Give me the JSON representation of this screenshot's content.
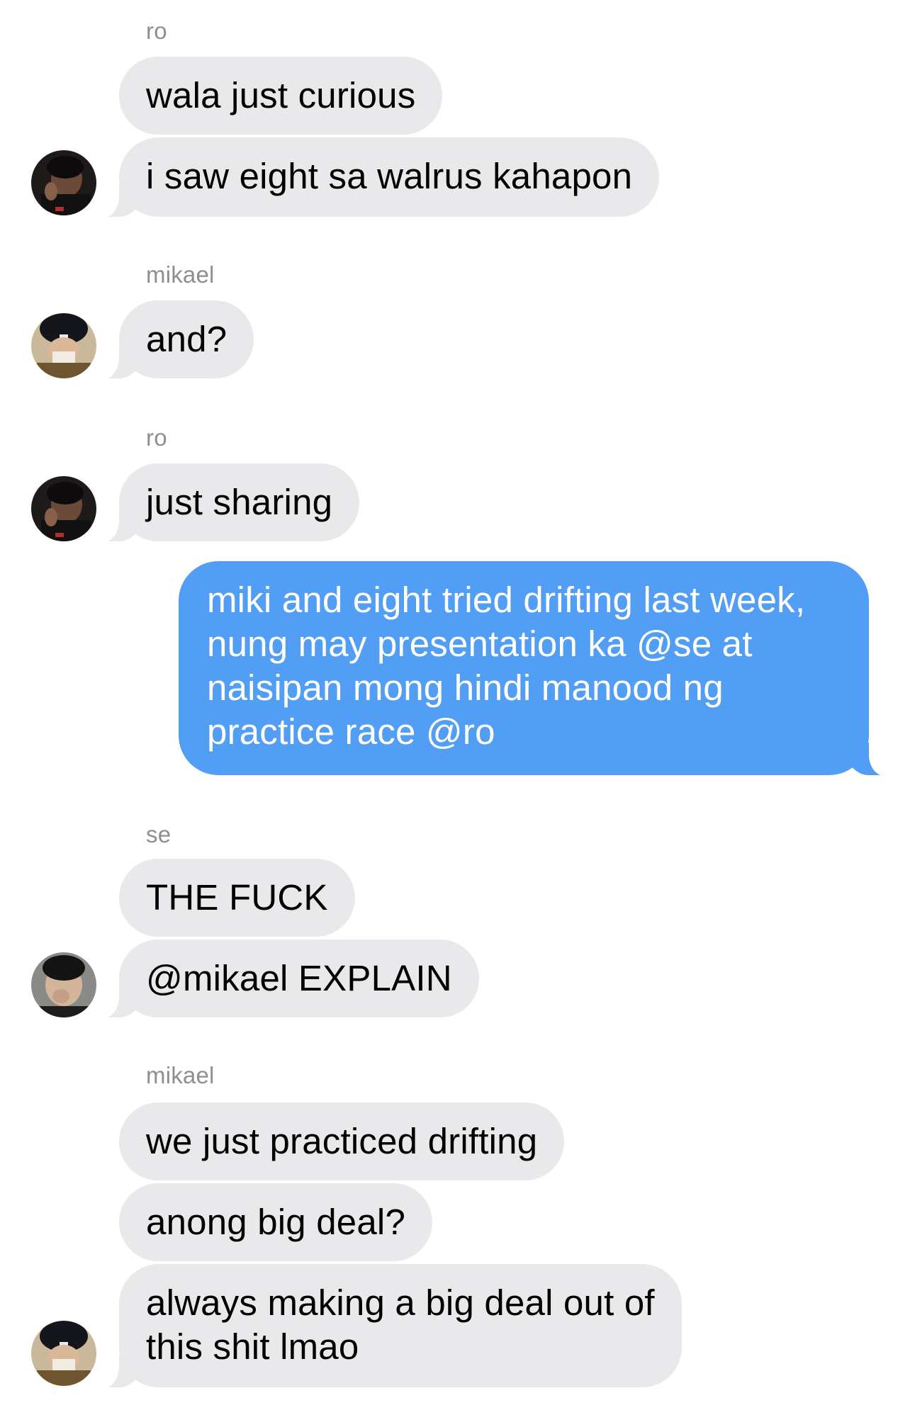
{
  "messages": [
    {
      "sender": "ro",
      "texts": [
        "wala just curious",
        "i saw eight sa walrus kahapon"
      ],
      "avatar_icon": "ro-avatar-icon"
    },
    {
      "sender": "mikael",
      "texts": [
        "and?"
      ],
      "avatar_icon": "mikael-avatar-icon"
    },
    {
      "sender": "ro",
      "texts": [
        "just sharing"
      ],
      "avatar_icon": "ro-avatar-icon"
    },
    {
      "sender": "",
      "outgoing": true,
      "texts": [
        "miki and eight tried drifting last week,\nnung may presentation ka @se at\nnaisipan mong hindi manood ng\npractice race @ro"
      ]
    },
    {
      "sender": "se",
      "texts": [
        "THE FUCK",
        "@mikael EXPLAIN"
      ],
      "avatar_icon": "se-avatar-icon"
    },
    {
      "sender": "mikael",
      "texts": [
        "we just practiced drifting",
        "anong big deal?",
        "always making a big deal out of\nthis shit lmao"
      ],
      "avatar_icon": "mikael-avatar-icon"
    }
  ],
  "colors": {
    "incoming_bubble": "#e9e9eb",
    "outgoing_bubble": "#539ef5",
    "sender_name": "#8e8e93"
  }
}
